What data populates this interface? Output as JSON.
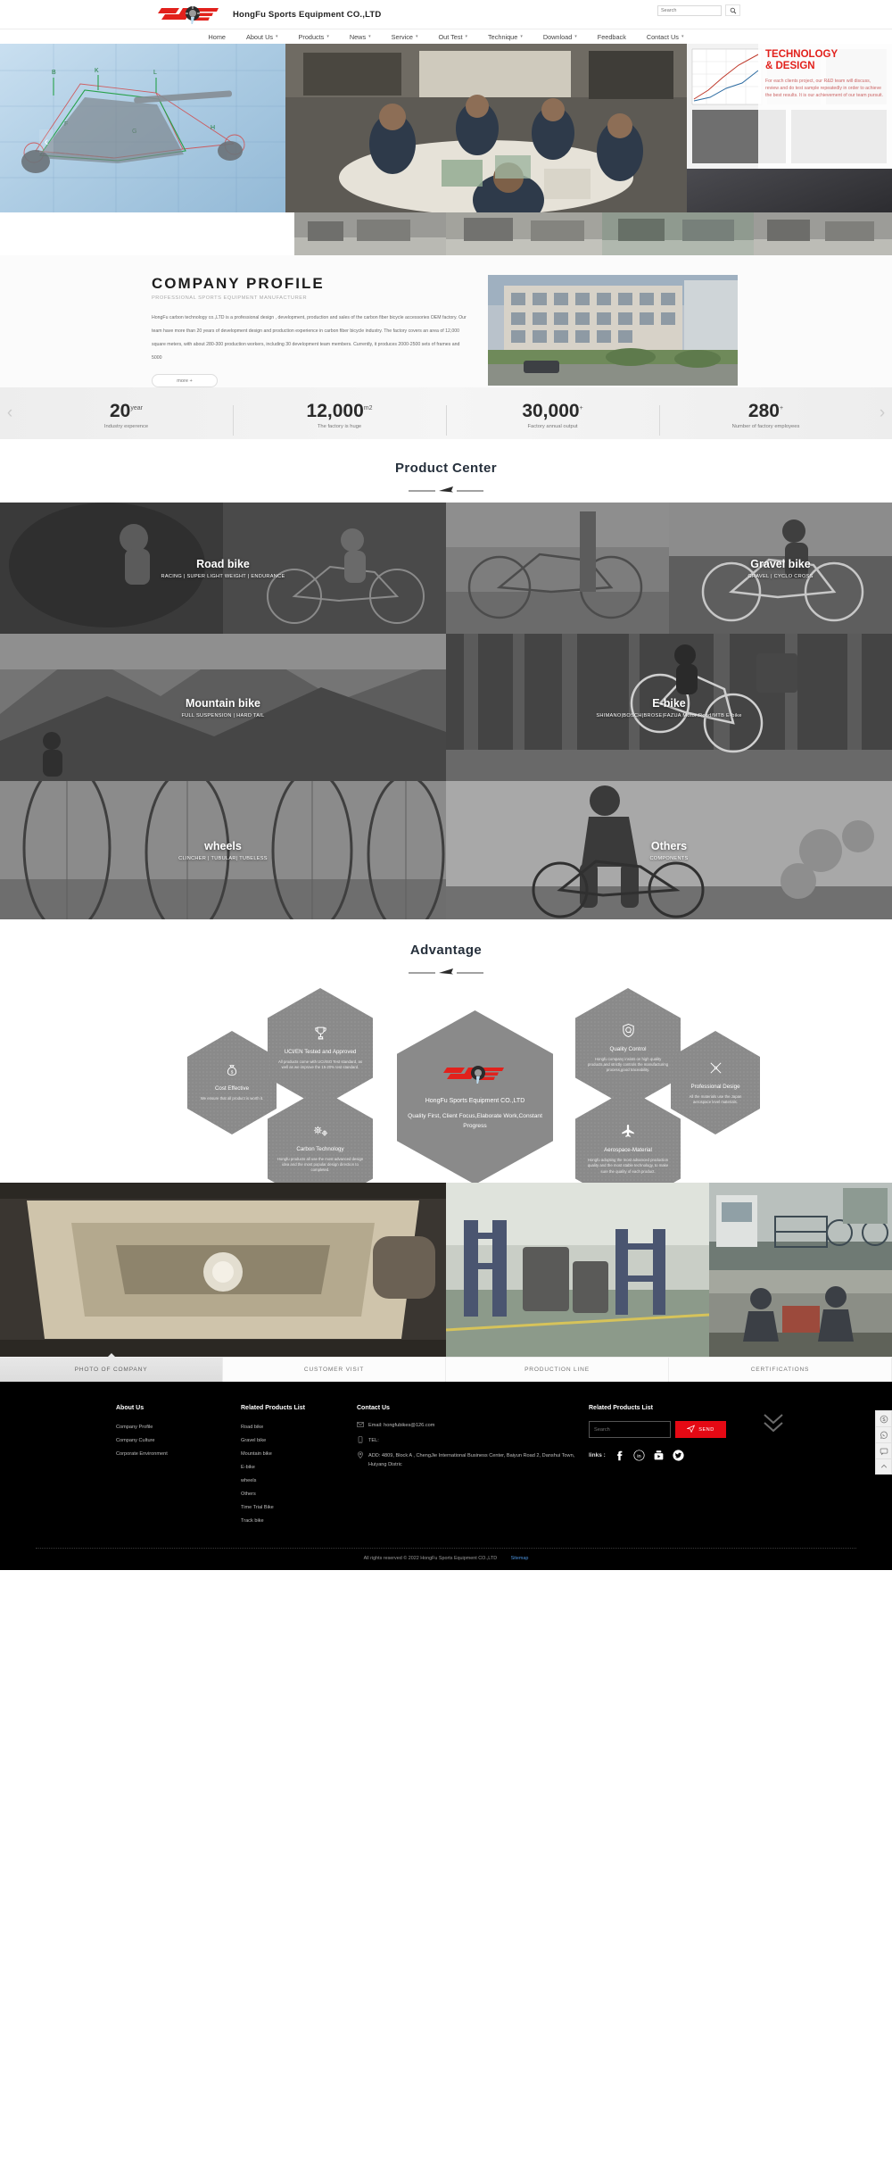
{
  "header": {
    "company_name": "HongFu Sports Equipment CO.,LTD",
    "logo_icon": "hf-chainring-logo",
    "search": {
      "placeholder": "Search",
      "value": "",
      "button_icon": "search-icon"
    }
  },
  "nav": {
    "items": [
      {
        "label": "Home",
        "has_caret": false
      },
      {
        "label": "About Us",
        "has_caret": true
      },
      {
        "label": "Products",
        "has_caret": true
      },
      {
        "label": "News",
        "has_caret": true
      },
      {
        "label": "Service",
        "has_caret": true
      },
      {
        "label": "Out Test",
        "has_caret": true
      },
      {
        "label": "Technique",
        "has_caret": true
      },
      {
        "label": "Download",
        "has_caret": true
      },
      {
        "label": "Feedback",
        "has_caret": false
      },
      {
        "label": "Contact Us",
        "has_caret": true
      }
    ],
    "caret_glyph": "▾"
  },
  "hero": {
    "prev_icon": "chevron-left-icon",
    "next_icon": "chevron-right-icon",
    "prev_glyph": "‹",
    "next_glyph": "›",
    "tech_title_line1": "TECHNOLOGY",
    "tech_title_line2": "& DESIGN",
    "tech_body": "For each clients project, our R&D team will discuss, review and do test sample repeatedly in order to achieve the best results. It is our achievement of our team pursuit.",
    "accent_red": "#e2211c"
  },
  "profile": {
    "title": "COMPANY PROFILE",
    "subtitle": "PROFESSIONAL SPORTS EQUIPMENT MANUFACTURER",
    "body": "HongFu carbon technology co.,LTD  is a professional design , development, production and sales of the carbon fiber bicycle accessories OEM factory. Our team have more than 20 years of development design and production experience in carbon fiber bicycle industry. The factory covers an area of 12,000 square meters, with about 280-300 production workers, including 30 development team members. Currently, it produces 2000-2500 sets of frames and 5000",
    "more_label": "more +",
    "image_alt": "factory-building-photo"
  },
  "stats": {
    "left_arrow_icon": "chevron-left-icon",
    "right_arrow_icon": "chevron-right-icon",
    "items": [
      {
        "value": "20",
        "unit": "year",
        "label": "Industry experence"
      },
      {
        "value": "12,000",
        "unit": "m2",
        "label": "The factory is huge"
      },
      {
        "value": "30,000",
        "unit": "+",
        "label": "Factory annual output"
      },
      {
        "value": "280",
        "unit": "+",
        "label": "Number of factory employees"
      }
    ]
  },
  "product_center": {
    "title": "Product Center",
    "ornament_icon": "paper-plane-divider-icon",
    "items": [
      {
        "title": "Road bike",
        "subtitle": "RACING | SUPER LIGHT WEIGHT | ENDURANCE"
      },
      {
        "title": "Gravel bike",
        "subtitle": "GRAVEL | CYCLO CROSS"
      },
      {
        "title": "Mountain bike",
        "subtitle": "FULL SUSPENSION | HARD TAIL"
      },
      {
        "title": "E-bike",
        "subtitle": "SHIMANO|BOSCH|BROSE|FAZUA Motor Road/MTB E-bike"
      },
      {
        "title": "wheels",
        "subtitle": "CLINCHER | TUBULAR| TUBELESS"
      },
      {
        "title": "Others",
        "subtitle": "COMPONENTS"
      }
    ]
  },
  "advantage": {
    "title": "Advantage",
    "ornament_icon": "paper-plane-divider-icon",
    "center": {
      "logo_icon": "hf-chainring-logo",
      "company": "HongFu Sports Equipment CO.,LTD",
      "slogan": "Quality First, Client Focus,Elaborate Work,Constant Progress"
    },
    "cells": [
      {
        "icon": "money-bag-icon",
        "title": "Cost Effective",
        "desc": "We ensure that all product is worth it."
      },
      {
        "icon": "trophy-icon",
        "title": "UCI/EN Tested and Approved",
        "desc": "All products come with UCI/ISO Test standard, as well as we improve the 15-20% test standard."
      },
      {
        "icon": "gears-icon",
        "title": "Carbon Technology",
        "desc": "Hongfu products all use the most advanced design idea and the most popular design direction to completed."
      },
      {
        "icon": "quality-shield-icon",
        "title": "Quality Control",
        "desc": "Hongfu company insists on high quality products,and strictly controls the manufacturing process,good traceability."
      },
      {
        "icon": "airplane-icon",
        "title": "Aerospace-Material",
        "desc": "Hongfu adopting the most advanced production quality and the most stable technology, to make sure the quality of each product."
      },
      {
        "icon": "tools-icon",
        "title": "Professional Desige",
        "desc": "All the materials use the Japan aerospace level materials."
      }
    ]
  },
  "gallery": {
    "images": [
      {
        "alt": "carbon-mold-photo"
      },
      {
        "alt": "warehouse-photo"
      },
      {
        "alt": "testing-lab-photo"
      },
      {
        "alt": "assembly-line-photo"
      }
    ]
  },
  "tabs": {
    "items": [
      {
        "label": "PHOTO OF COMPANY",
        "active": true
      },
      {
        "label": "CUSTOMER VISIT",
        "active": false
      },
      {
        "label": "PRODUCTION LINE",
        "active": false
      },
      {
        "label": "CERTIFICATIONS",
        "active": false
      }
    ]
  },
  "footer": {
    "about": {
      "title": "About Us",
      "links": [
        "Company Profile",
        "Company Culture",
        "Corporate Environment"
      ]
    },
    "products": {
      "title": "Related Products List",
      "links": [
        "Road bike",
        "Gravel bike",
        "Mountain bike",
        "E-bike",
        "wheels",
        "Others",
        "Time Trial Bike",
        "Track bike"
      ]
    },
    "contact": {
      "title": "Contact Us",
      "email_icon": "envelope-icon",
      "email": "Email: hongfubikes@126.com",
      "tel_icon": "phone-icon",
      "tel": "TEL:",
      "addr_icon": "location-pin-icon",
      "address": "ADD: 4809, Block A , ChengJie International Business Center, Baiyun Road 2, Danshui Town, Huiyang Distric"
    },
    "subscribe": {
      "title": "Related Products List",
      "search_placeholder": "Search",
      "search_value": "",
      "send_label": "SEND",
      "send_icon": "paper-plane-icon",
      "links_label": "links :",
      "socials": [
        {
          "icon": "facebook-icon",
          "glyph": "f"
        },
        {
          "icon": "linkedin-icon",
          "glyph": "in"
        },
        {
          "icon": "youtube-icon",
          "glyph": "▶"
        },
        {
          "icon": "twitter-icon",
          "glyph": "🐦"
        }
      ]
    },
    "scroll_chevrons_icon": "double-chevron-down-icon",
    "copyright": "All rights reserved © 2022 HongFu Sports Equipment CO.,LTD",
    "sitemap_label": "Sitemap"
  },
  "side_tools": {
    "items": [
      {
        "icon": "skype-icon"
      },
      {
        "icon": "whatsapp-icon"
      },
      {
        "icon": "message-icon"
      },
      {
        "icon": "scroll-up-icon"
      }
    ],
    "back_to_top_icon": "double-chevron-up-icon"
  }
}
